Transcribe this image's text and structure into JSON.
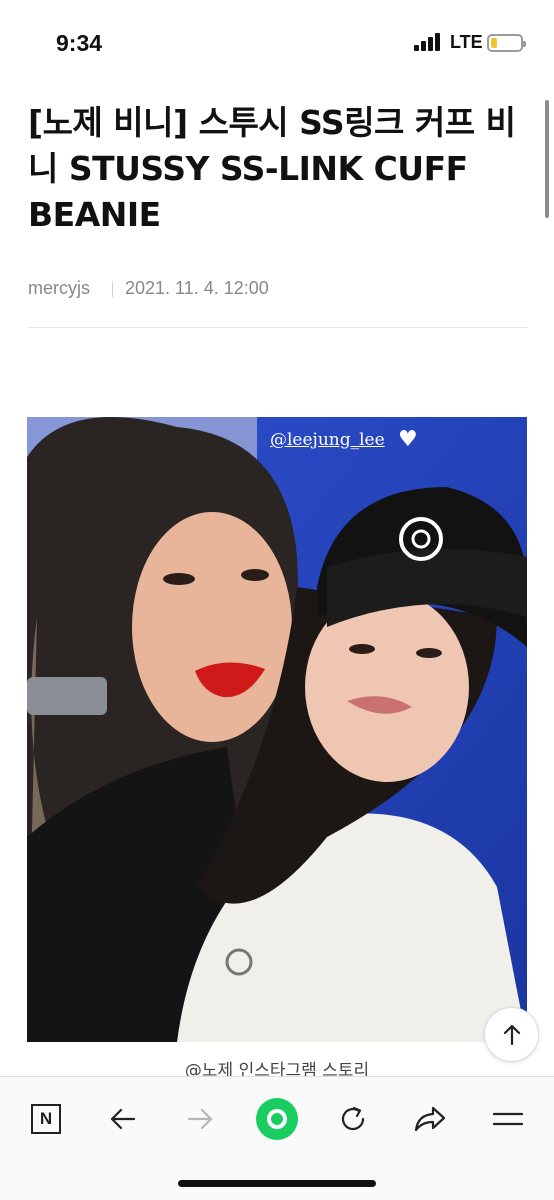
{
  "status_bar": {
    "time": "9:34",
    "network": "LTE",
    "battery_level": 0.2,
    "battery_color": "#f4c430"
  },
  "article": {
    "title": "[노제 비니] 스투시 SS링크 커프 비니 STUSSY SS-LINK CUFF BEANIE",
    "author": "mercyjs",
    "date": "2021. 11. 4. 12:00"
  },
  "photo": {
    "story_tag": "@leejung_lee",
    "heart": "♥",
    "background_color": "#1f3fb0"
  },
  "caption": "@노제 인스타그램 스토리",
  "toolbar": {
    "home_icon_label": "N",
    "accent_color": "#19ce60",
    "icons": [
      "naver-home-icon",
      "back-arrow-icon",
      "forward-arrow-icon",
      "green-dot-icon",
      "refresh-icon",
      "share-icon",
      "menu-icon"
    ]
  }
}
